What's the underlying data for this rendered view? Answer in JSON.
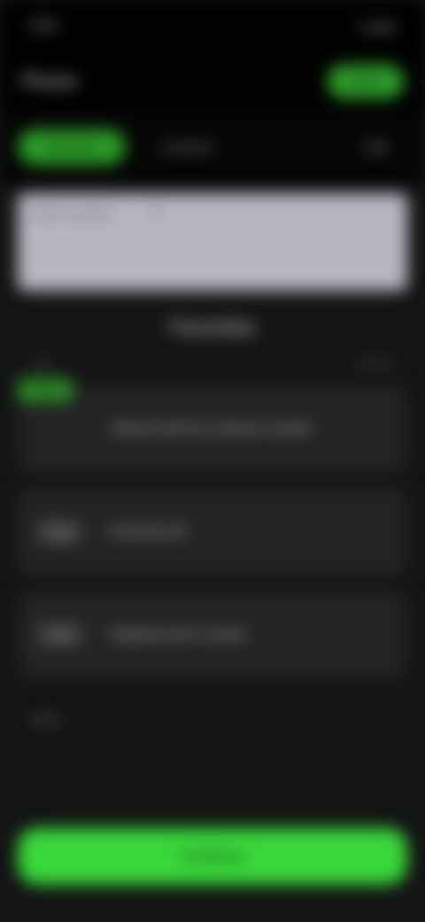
{
  "status": {
    "time": "9:41",
    "icons": "● ▮ ▮"
  },
  "topbar": {
    "title": "Phone",
    "action": "Done"
  },
  "tabs": [
    {
      "label": "Recents"
    },
    {
      "label": "Contacts"
    },
    {
      "label": "Edit"
    }
  ],
  "banner": {
    "title": "Add contacts",
    "subtitle": "▼"
  },
  "section": {
    "title": "Favorites"
  },
  "list_head": {
    "left": "Top",
    "right": "See all"
  },
  "rows": [
    {
      "tag": "New",
      "text": "Missed call from unknown number"
    },
    {
      "tag": "Today",
      "text": "Incoming call"
    },
    {
      "tag": "Today",
      "text": "Outgoing call to contact"
    }
  ],
  "more_label": "More",
  "cta": {
    "label": "Continue"
  }
}
